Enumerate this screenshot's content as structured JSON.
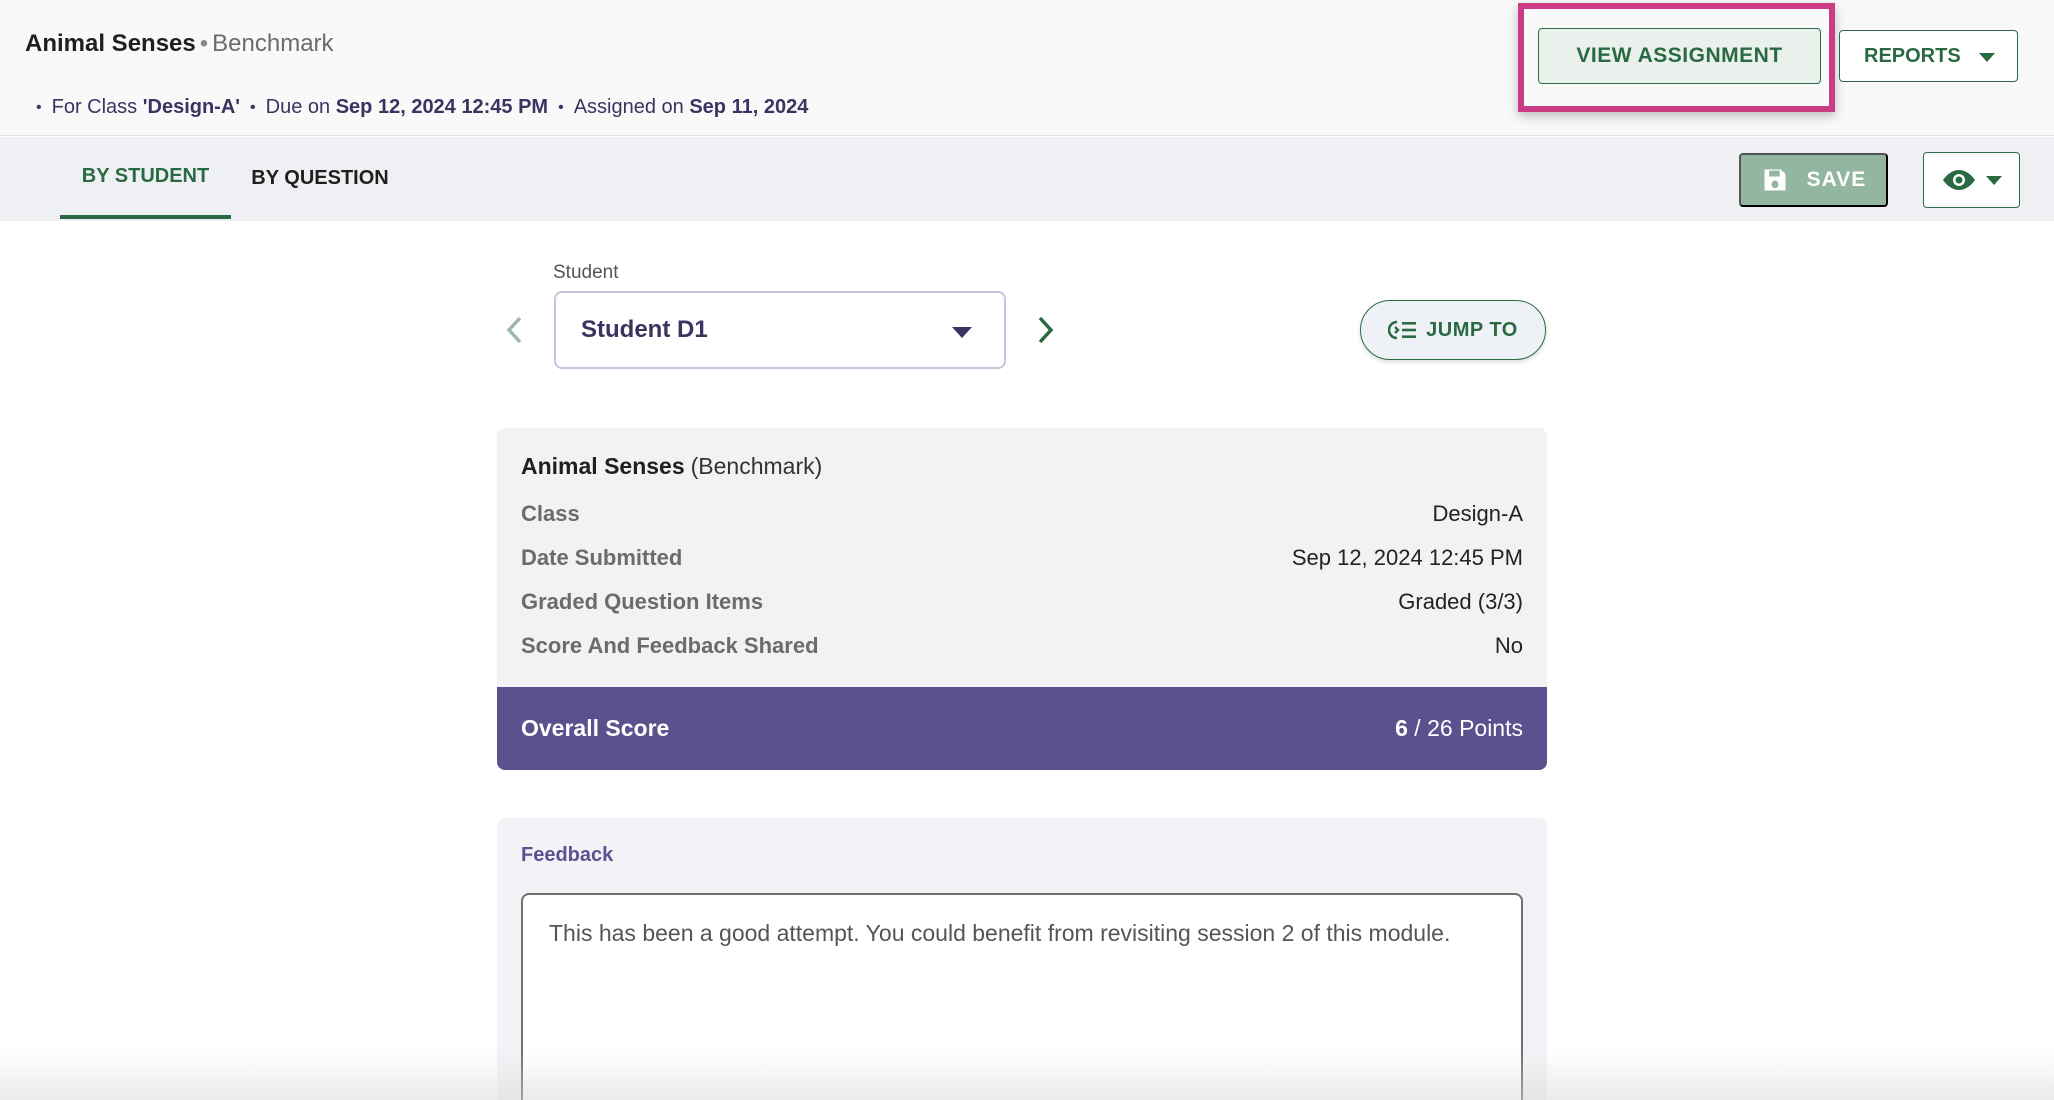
{
  "header": {
    "title": "Animal Senses",
    "subtitle": "Benchmark",
    "meta": {
      "class_prefix": "For Class",
      "class_name": "'Design-A'",
      "due_prefix": "Due on",
      "due_date": "Sep 12, 2024 12:45 PM",
      "assigned_prefix": "Assigned on",
      "assigned_date": "Sep 11, 2024"
    },
    "view_assignment_label": "VIEW ASSIGNMENT",
    "reports_label": "REPORTS"
  },
  "tabs": {
    "by_student": "BY STUDENT",
    "by_question": "BY QUESTION",
    "active": "by_student"
  },
  "toolbar": {
    "save_label": "SAVE",
    "visibility_icon": "eye-icon"
  },
  "student": {
    "label": "Student",
    "selected": "Student D1",
    "jump_label": "JUMP TO"
  },
  "summary": {
    "title": "Animal Senses",
    "type": "(Benchmark)",
    "rows": [
      {
        "key": "Class",
        "value": "Design-A"
      },
      {
        "key": "Date Submitted",
        "value": "Sep 12, 2024 12:45 PM"
      },
      {
        "key": "Graded Question Items",
        "value": "Graded (3/3)"
      },
      {
        "key": "Score And Feedback Shared",
        "value": "No"
      }
    ],
    "overall_label": "Overall Score",
    "score": "6",
    "score_total": " / 26 Points"
  },
  "feedback": {
    "label": "Feedback",
    "text": "This has been a good attempt. You could benefit from revisiting session 2 of this module."
  },
  "colors": {
    "accent_green": "#2a6a43",
    "accent_purple": "#5a528e",
    "highlight": "#cc3c84"
  }
}
